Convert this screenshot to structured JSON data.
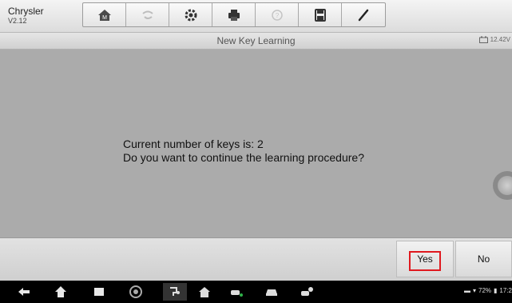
{
  "app": {
    "name": "Chrysler",
    "version": "V2.12"
  },
  "toolbar": {
    "buttons": [
      {
        "icon": "home-icon"
      },
      {
        "icon": "vehicle-swap-icon"
      },
      {
        "icon": "settings-icon"
      },
      {
        "icon": "print-icon"
      },
      {
        "icon": "help-icon"
      },
      {
        "icon": "save-icon"
      },
      {
        "icon": "pen-icon"
      }
    ]
  },
  "titlebar": {
    "title": "New Key Learning",
    "battery_voltage": "12.42V"
  },
  "message": {
    "line1": "Current number of keys is: 2",
    "line2": "Do you want to continue the learning procedure?"
  },
  "footer": {
    "yes_label": "Yes",
    "no_label": "No"
  },
  "colors": {
    "highlight": "#e0191f",
    "content_bg": "#ababab"
  },
  "statusbar": {
    "battery": "72%",
    "time": "17:2"
  }
}
